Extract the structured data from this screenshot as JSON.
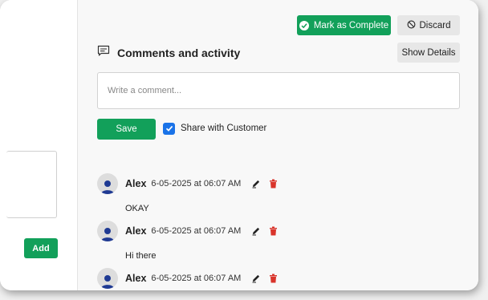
{
  "left": {
    "add_label": "Add"
  },
  "toolbar": {
    "complete_label": "Mark as Complete",
    "discard_label": "Discard",
    "details_label": "Show Details"
  },
  "comments": {
    "title": "Comments and activity",
    "placeholder": "Write a comment...",
    "save_label": "Save",
    "share_label": "Share with Customer",
    "share_checked": true,
    "entries": [
      {
        "author": "Alex",
        "timestamp": "6-05-2025 at 06:07 AM",
        "text": "OKAY"
      },
      {
        "author": "Alex",
        "timestamp": "6-05-2025 at 06:07 AM",
        "text": "Hi there"
      },
      {
        "author": "Alex",
        "timestamp": "6-05-2025 at 06:07 AM",
        "text": ""
      }
    ]
  },
  "icons": {
    "complete": "check-circle-icon",
    "discard": "ban-icon",
    "section": "comment-icon",
    "edit": "pencil-icon",
    "delete": "trash-icon",
    "avatar": "user-icon"
  },
  "colors": {
    "primary": "#12a05a",
    "secondary_button": "#e7e7e7",
    "checkbox": "#1a73e8",
    "delete": "#d9342b",
    "avatar_figure": "#1f3a93"
  }
}
